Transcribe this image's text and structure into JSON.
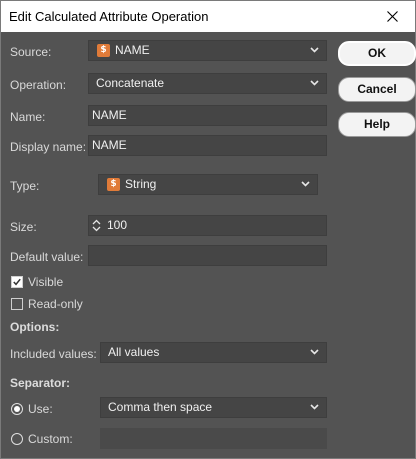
{
  "window": {
    "title": "Edit Calculated Attribute Operation"
  },
  "form": {
    "source_label": "Source:",
    "source_value": "NAME",
    "operation_label": "Operation:",
    "operation_value": "Concatenate",
    "name_label": "Name:",
    "name_value": "NAME",
    "display_name_label": "Display name:",
    "display_name_value": "NAME",
    "type_label": "Type:",
    "type_value": "String",
    "size_label": "Size:",
    "size_value": "100",
    "default_value_label": "Default value:",
    "default_value": "",
    "visible_label": "Visible",
    "visible_checked": true,
    "readonly_label": "Read-only",
    "readonly_checked": false,
    "options_heading": "Options:",
    "included_values_label": "Included values:",
    "included_values_value": "All values",
    "separator_heading": "Separator:",
    "use_label": "Use:",
    "use_selected": true,
    "use_value": "Comma then space",
    "custom_label": "Custom:",
    "custom_value": ""
  },
  "buttons": {
    "ok": "OK",
    "cancel": "Cancel",
    "help": "Help"
  },
  "icons": {
    "type_icon": "string-type-icon",
    "source_icon": "string-type-icon"
  },
  "colors": {
    "background": "#535353",
    "field": "#454545",
    "type_icon": "#e07b39"
  }
}
